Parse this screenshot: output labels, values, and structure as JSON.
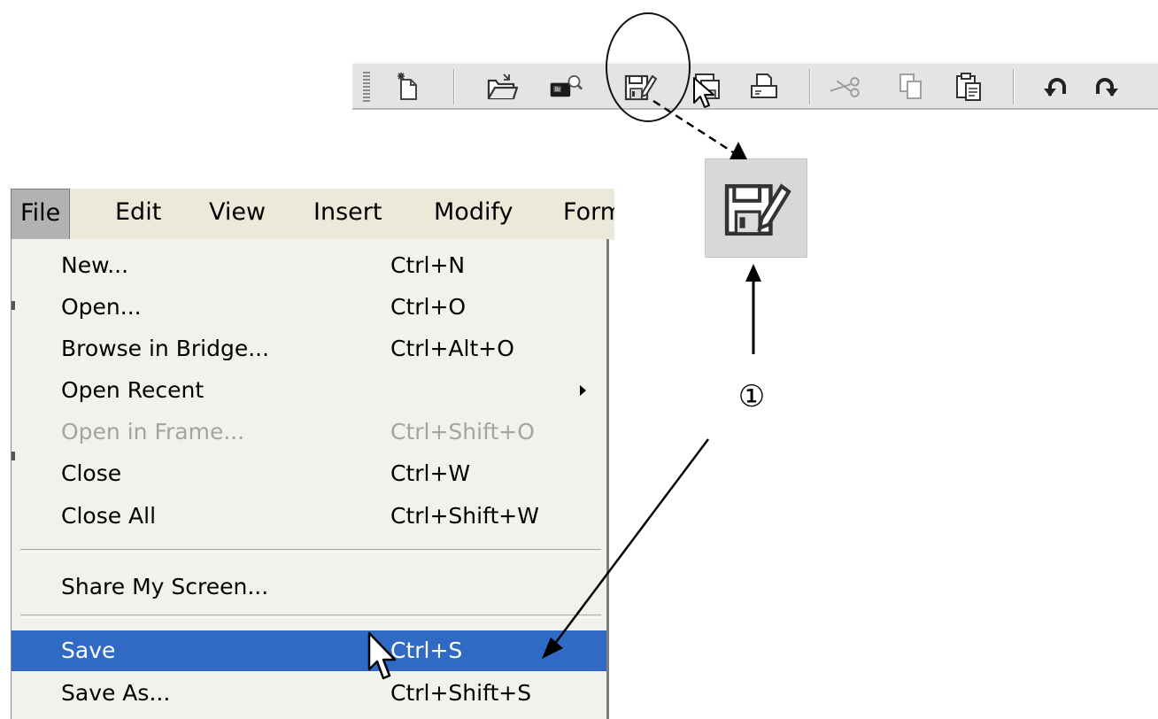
{
  "toolbar": {
    "buttons": [
      {
        "name": "new-document",
        "icon": "new-document-icon",
        "enabled": true
      },
      {
        "name": "open",
        "icon": "open-folder-icon",
        "enabled": true
      },
      {
        "name": "browse-in-bridge",
        "icon": "bridge-icon",
        "enabled": true
      },
      {
        "name": "save",
        "icon": "save-icon",
        "enabled": true
      },
      {
        "name": "save-all",
        "icon": "save-all-icon",
        "enabled": true
      },
      {
        "name": "print",
        "icon": "print-icon",
        "enabled": true
      },
      {
        "name": "cut",
        "icon": "scissors-icon",
        "enabled": false
      },
      {
        "name": "copy",
        "icon": "copy-icon",
        "enabled": false
      },
      {
        "name": "paste",
        "icon": "paste-icon",
        "enabled": true
      },
      {
        "name": "undo",
        "icon": "undo-icon",
        "enabled": true
      },
      {
        "name": "redo",
        "icon": "redo-icon",
        "enabled": true
      }
    ]
  },
  "callout": {
    "step_marker": "①",
    "enlarged_icon": "save-icon"
  },
  "menubar": {
    "items": [
      {
        "label": "File",
        "active": true
      },
      {
        "label": "Edit"
      },
      {
        "label": "View"
      },
      {
        "label": "Insert"
      },
      {
        "label": "Modify"
      },
      {
        "label": "Format"
      }
    ]
  },
  "file_menu": {
    "items": [
      {
        "label": "New...",
        "shortcut": "Ctrl+N"
      },
      {
        "label": "Open...",
        "shortcut": "Ctrl+O"
      },
      {
        "label": "Browse in Bridge...",
        "shortcut": "Ctrl+Alt+O"
      },
      {
        "label": "Open Recent",
        "shortcut": "",
        "submenu": true
      },
      {
        "label": "Open in Frame...",
        "shortcut": "Ctrl+Shift+O",
        "disabled": true
      },
      {
        "label": "Close",
        "shortcut": "Ctrl+W"
      },
      {
        "label": "Close All",
        "shortcut": "Ctrl+Shift+W"
      },
      {
        "label": "Share My Screen...",
        "shortcut": ""
      },
      {
        "label": "Save",
        "shortcut": "Ctrl+S",
        "selected": true
      },
      {
        "label": "Save As...",
        "shortcut": "Ctrl+Shift+S"
      }
    ]
  },
  "colors": {
    "selection": "#316ac5",
    "menu_background": "#f2f1ec",
    "toolbar_background": "#e4e4e4",
    "disabled_text": "#a4a4a4"
  }
}
